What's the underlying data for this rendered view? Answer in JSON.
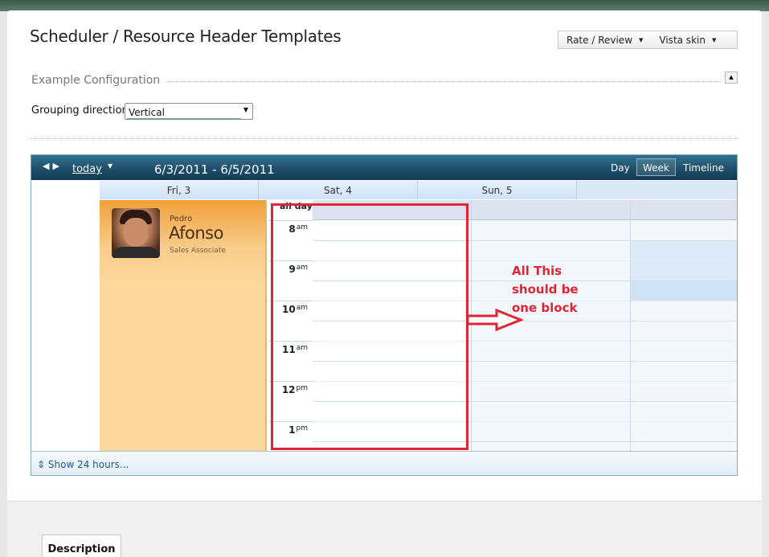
{
  "page": {
    "title": "Scheduler / Resource Header Templates",
    "menu": [
      {
        "label": "Rate / Review"
      },
      {
        "label": "Vista skin"
      }
    ]
  },
  "config": {
    "section_label": "Example Configuration",
    "grouping_label": "Grouping direction:",
    "grouping_value": "Vertical"
  },
  "scheduler": {
    "today_label": "today",
    "date_range": "6/3/2011 - 6/5/2011",
    "views": [
      "Day",
      "Week",
      "Timeline"
    ],
    "selected_view": "Week",
    "days": [
      "Fri, 3",
      "Sat, 4",
      "Sun, 5"
    ],
    "allday_label": "all day",
    "hours": [
      {
        "num": "8",
        "suffix": "am"
      },
      {
        "num": "9",
        "suffix": "am"
      },
      {
        "num": "10",
        "suffix": "am"
      },
      {
        "num": "11",
        "suffix": "am"
      },
      {
        "num": "12",
        "suffix": "pm"
      },
      {
        "num": "1",
        "suffix": "pm"
      }
    ],
    "resource": {
      "first_name": "Pedro",
      "last_name": "Afonso",
      "role": "Sales Associate"
    },
    "footer_link": "Show 24 hours..."
  },
  "annotation": {
    "text_line1": "All This",
    "text_line2": "should be",
    "text_line3": "one block",
    "color": "#e12535"
  },
  "bottom": {
    "tab_label": "Description"
  },
  "colors": {
    "header_bar": "#1e4e6a",
    "resource_bg": "#fdd79b",
    "accent": "#1c5a92"
  }
}
